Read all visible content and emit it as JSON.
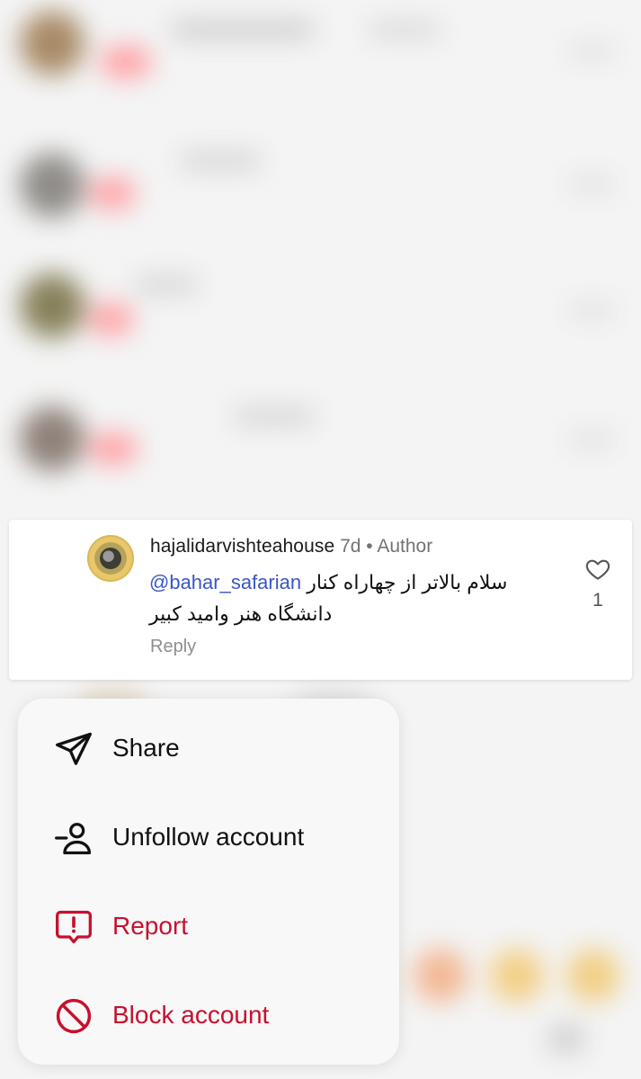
{
  "comment": {
    "username": "hajalidarvishteahouse",
    "time": "7d",
    "separator": "•",
    "role": "Author",
    "mention": "@bahar_safarian",
    "text_line1": "سلام بالاتر از چهاراه  کنار",
    "text_line2": "دانشگاه هنر وامید کبیر",
    "reply_label": "Reply",
    "like_count": "1",
    "like_icon": "heart-outline-icon"
  },
  "menu": {
    "items": [
      {
        "label": "Share",
        "icon": "send-icon",
        "color": "#111111"
      },
      {
        "label": "Unfollow account",
        "icon": "unfollow-user-icon",
        "color": "#111111"
      },
      {
        "label": "Report",
        "icon": "report-icon",
        "color": "#c8102e"
      },
      {
        "label": "Block account",
        "icon": "block-icon",
        "color": "#c8102e"
      }
    ]
  },
  "colors": {
    "danger": "#c8102e",
    "mention": "#3a56c4",
    "muted": "#737373"
  }
}
